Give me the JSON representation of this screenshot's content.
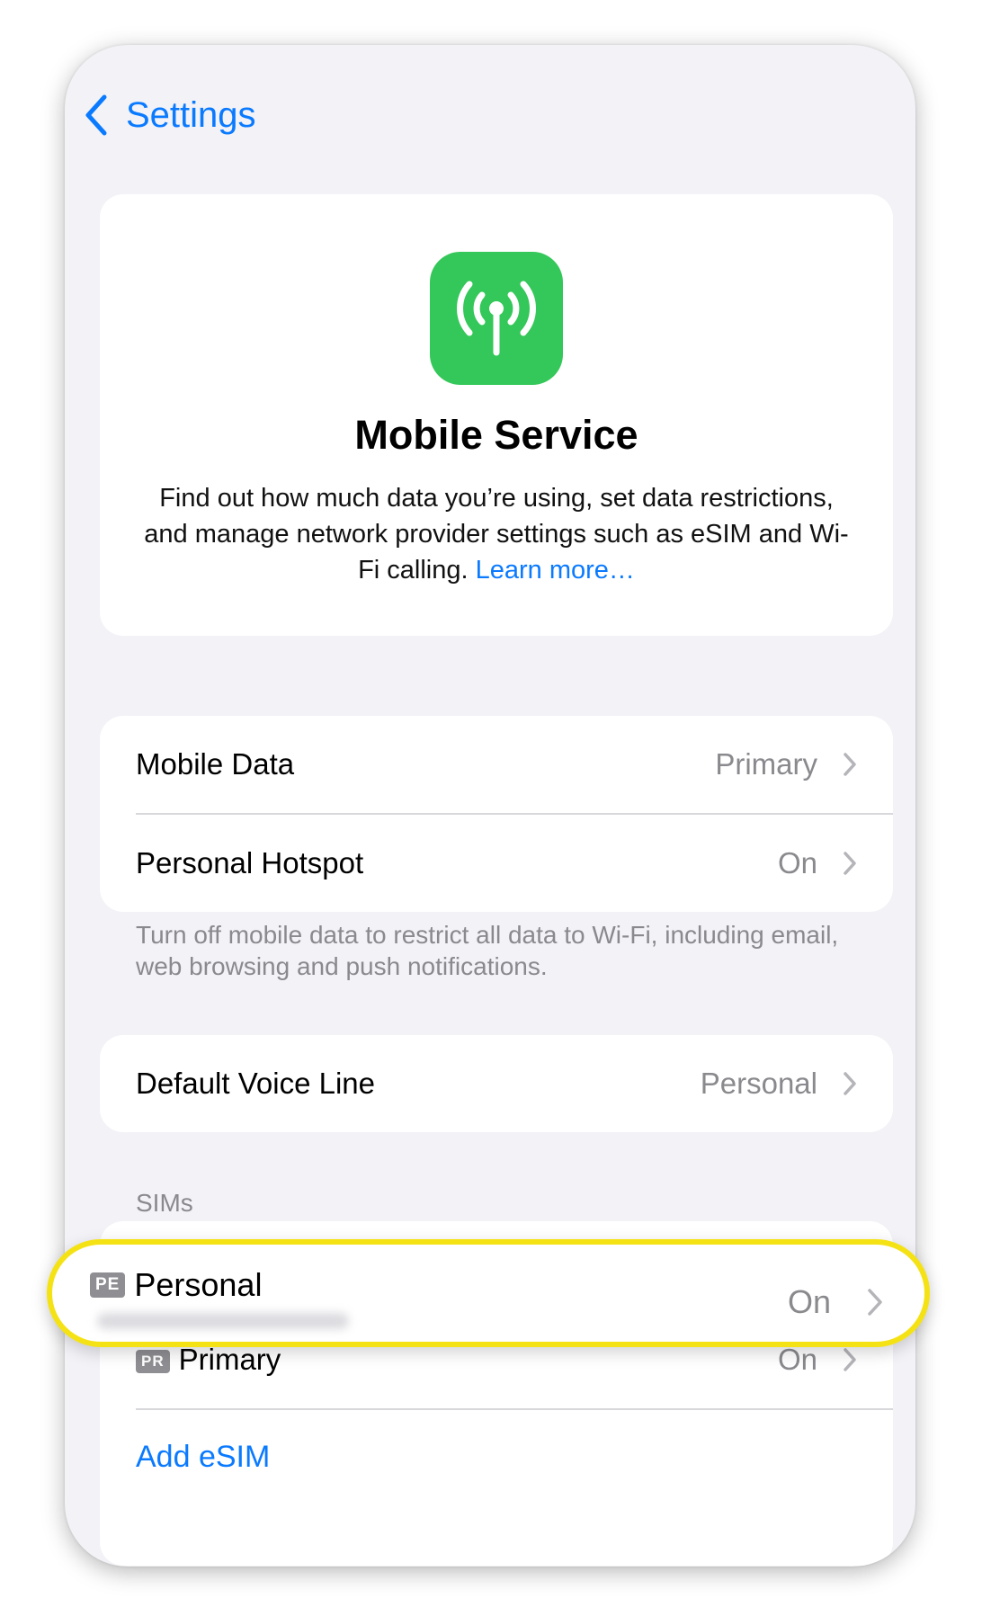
{
  "nav": {
    "back_label": "Settings"
  },
  "hero": {
    "icon": "antenna-radiowaves-icon",
    "title": "Mobile Service",
    "description": "Find out how much data you’re using, set data restrictions, and manage network provider settings such as eSIM and Wi-Fi calling.",
    "link": "Learn more…"
  },
  "data_group": {
    "rows": [
      {
        "label": "Mobile Data",
        "value": "Primary"
      },
      {
        "label": "Personal Hotspot",
        "value": "On"
      }
    ],
    "footnote": "Turn off mobile data to restrict all data to Wi-Fi, including email, web browsing and push notifications."
  },
  "voice_group": {
    "label": "Default Voice Line",
    "value": "Personal"
  },
  "sims": {
    "header": "SIMs",
    "items": [
      {
        "badge": "PE",
        "label": "Personal",
        "value": "On"
      },
      {
        "badge": "PR",
        "label": "Primary",
        "value": "On"
      }
    ],
    "add_label": "Add eSIM"
  },
  "colors": {
    "accent": "#0a7aff",
    "icon_green": "#34c759",
    "highlight": "#f5e214"
  }
}
